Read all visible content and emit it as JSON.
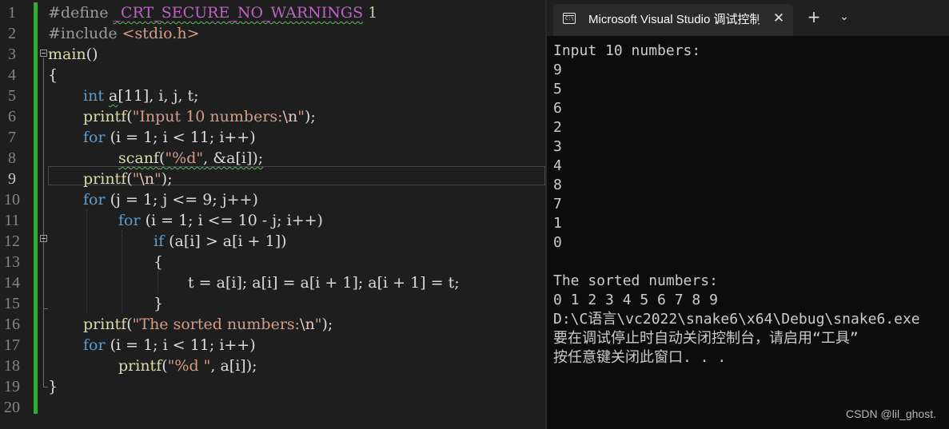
{
  "editor": {
    "line_numbers": [
      "1",
      "2",
      "3",
      "4",
      "5",
      "6",
      "7",
      "8",
      "9",
      "10",
      "11",
      "12",
      "13",
      "14",
      "15",
      "16",
      "17",
      "18",
      "19",
      "20"
    ],
    "active_line": "9",
    "code": {
      "l1_pp": "#define ",
      "l1_macro": "_CRT_SECURE_NO_WARNINGS",
      "l1_num": " 1",
      "l2_pp": "#include ",
      "l2_hdr": "<stdio.h>",
      "l3_fn": "main",
      "l3_rest": "()",
      "l4": "{",
      "l5_kw": "int",
      "l5_a": "a",
      "l5_rest": "[11], i, j, t;",
      "l6_fn": "printf",
      "l6_open": "(",
      "l6_str": "\"Input 10 numbers:",
      "l6_esc": "\\n",
      "l6_q": "\"",
      "l6_close": ");",
      "l7_kw": "for",
      "l7_rest": " (i = 1; i < 11; i++)",
      "l8_fn": "scanf",
      "l8_open": "(",
      "l8_str": "\"%d\"",
      "l8_rest": ", &a[i]);",
      "l9_fn": "printf",
      "l9_open": "(",
      "l9_q1": "\"",
      "l9_esc": "\\n",
      "l9_q2": "\"",
      "l9_close": ");",
      "l10_kw": "for",
      "l10_rest": " (j = 1; j <= 9; j++)",
      "l11_kw": "for",
      "l11_rest": " (i = 1; i <= 10 - j; i++)",
      "l12_kw": "if",
      "l12_rest": " (a[i] > a[i + 1])",
      "l13": "{",
      "l14": "t = a[i]; a[i] = a[i + 1]; a[i + 1] = t;",
      "l15": "}",
      "l16_fn": "printf",
      "l16_open": "(",
      "l16_str": "\"The sorted numbers:",
      "l16_esc": "\\n",
      "l16_q": "\"",
      "l16_close": ");",
      "l17_kw": "for",
      "l17_rest": " (i = 1; i < 11; i++)",
      "l18_fn": "printf",
      "l18_open": "(",
      "l18_str": "\"%d \"",
      "l18_rest": ", a[i]);",
      "l19": "}"
    }
  },
  "terminal": {
    "tab_title": "Microsoft Visual Studio 调试控制台",
    "close_glyph": "✕",
    "new_tab_glyph": "+",
    "dropdown_glyph": "⌄",
    "output": [
      "Input 10 numbers:",
      "9",
      "5",
      "6",
      "2",
      "3",
      "4",
      "8",
      "7",
      "1",
      "0",
      "",
      "The sorted numbers:",
      "0 1 2 3 4 5 6 7 8 9",
      "D:\\C语言\\vc2022\\snake6\\x64\\Debug\\snake6.exe",
      "要在调试停止时自动关闭控制台，请启用“工具”",
      "按任意键关闭此窗口. . ."
    ]
  },
  "watermark": "CSDN @lil_ghost.",
  "colors": {
    "keyword": "#569cd6",
    "string": "#d69d85",
    "function": "#dcdcaa",
    "preprocessor": "#9b9b9b",
    "macro": "#bd63c5",
    "change_bar": "#37a834",
    "terminal_bg": "#0c0c0c",
    "editor_bg": "#1e1e1e"
  }
}
